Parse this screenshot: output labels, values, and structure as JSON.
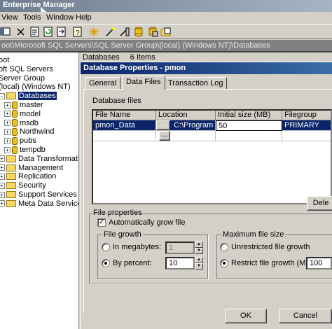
{
  "window": {
    "title": "Enterprise Manager"
  },
  "menu": [
    "View",
    "Tools",
    "Window",
    "Help"
  ],
  "address": "oot\\Microsoft SQL Servers\\SQL Server Group\\(local) (Windows NT)\\Databases",
  "tree": {
    "items": [
      {
        "label": "oot",
        "indent": 0,
        "icon": "none",
        "expand": ""
      },
      {
        "label": "oft SQL Servers",
        "indent": 0,
        "icon": "none",
        "expand": ""
      },
      {
        "label": "Server Group",
        "indent": 1,
        "icon": "none",
        "expand": ""
      },
      {
        "label": "(local) (Windows NT)",
        "indent": 1,
        "icon": "none",
        "expand": ""
      },
      {
        "label": "Databases",
        "indent": 1,
        "icon": "folder",
        "expand": "-",
        "selected": true
      },
      {
        "label": "master",
        "indent": 2,
        "icon": "db",
        "expand": "+"
      },
      {
        "label": "model",
        "indent": 2,
        "icon": "db",
        "expand": "+"
      },
      {
        "label": "msdb",
        "indent": 2,
        "icon": "db",
        "expand": "+"
      },
      {
        "label": "Northwind",
        "indent": 2,
        "icon": "db",
        "expand": "+"
      },
      {
        "label": "pubs",
        "indent": 2,
        "icon": "db",
        "expand": "+"
      },
      {
        "label": "tempdb",
        "indent": 2,
        "icon": "db",
        "expand": "+"
      },
      {
        "label": "Data Transformation Ser",
        "indent": 1,
        "icon": "folder",
        "expand": "+"
      },
      {
        "label": "Management",
        "indent": 1,
        "icon": "folder",
        "expand": "+"
      },
      {
        "label": "Replication",
        "indent": 1,
        "icon": "folder",
        "expand": "+"
      },
      {
        "label": "Security",
        "indent": 1,
        "icon": "folder",
        "expand": "+"
      },
      {
        "label": "Support Services",
        "indent": 1,
        "icon": "folder",
        "expand": "+"
      },
      {
        "label": "Meta Data Services",
        "indent": 1,
        "icon": "folder",
        "expand": "+"
      }
    ]
  },
  "right_header": {
    "label": "Databases",
    "count": "6 Items"
  },
  "dialog": {
    "title": "Database Properties - pmon",
    "tabs": [
      "General",
      "Data Files",
      "Transaction Log"
    ],
    "active_tab": "Data Files",
    "db_files_label": "Database files",
    "grid": {
      "columns": [
        "File Name",
        "Location",
        "Initial size (MB)",
        "Filegroup"
      ],
      "rows": [
        {
          "name": "pmon_Data",
          "location": "C:\\Program ...",
          "size": "50",
          "filegroup": "PRIMARY"
        }
      ]
    },
    "delete_button": "Dele",
    "file_properties_label": "File properties",
    "auto_grow_label": "Automatically grow file",
    "auto_grow_checked": true,
    "file_growth": {
      "legend": "File growth",
      "megabytes_label": "In megabytes:",
      "megabytes_value": "1",
      "percent_label": "By percent:",
      "percent_value": "10",
      "selected": "percent"
    },
    "max_size": {
      "legend": "Maximum file size",
      "unrestricted_label": "Unrestricted file growth",
      "restrict_label": "Restrict file growth (MB):",
      "restrict_value": "100",
      "selected": "restrict"
    },
    "ok_label": "OK",
    "cancel_label": "Cancel"
  },
  "colors": {
    "selection": "#0a246a",
    "title_active": "#0a246a",
    "face": "#d4d0c8"
  }
}
